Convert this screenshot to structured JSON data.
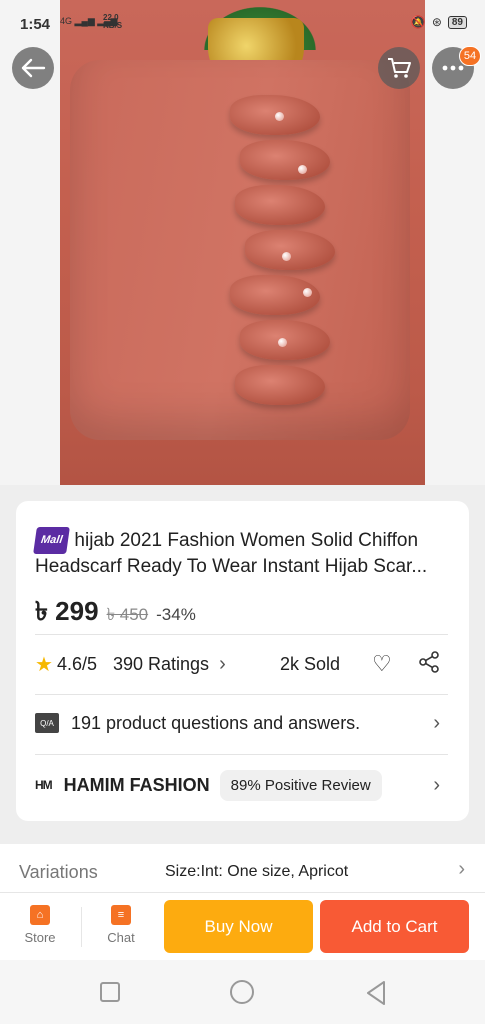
{
  "status_bar": {
    "time": "1:54",
    "network": "4G",
    "speed_value": "22.0",
    "speed_unit": "KB/S",
    "battery": "89"
  },
  "header": {
    "cart_badge": "54"
  },
  "product": {
    "mall_tag": "Mall",
    "title": "hijab 2021 Fashion Women Solid Chiffon Headscarf Ready To Wear Instant Hijab Scar...",
    "price": "৳ 299",
    "old_price": "৳ 450",
    "discount": "-34%"
  },
  "rating": {
    "score": "4.6/5",
    "count": "390 Ratings",
    "sold": "2k Sold"
  },
  "qa": {
    "icon_text": "Q/A",
    "text": "191 product questions and answers."
  },
  "store": {
    "logo": "HM",
    "name": "HAMIM FASHION",
    "review": "89% Positive Review"
  },
  "variations": {
    "label": "Variations",
    "value": "Size:Int: One size, Apricot"
  },
  "actions": {
    "store": "Store",
    "chat": "Chat",
    "buy_now": "Buy Now",
    "add_to_cart": "Add to Cart"
  },
  "colors": {
    "accent": "#f57224",
    "buy_now": "#fdab0f",
    "add_to_cart": "#f85a35",
    "mall": "#5b2ca3"
  }
}
